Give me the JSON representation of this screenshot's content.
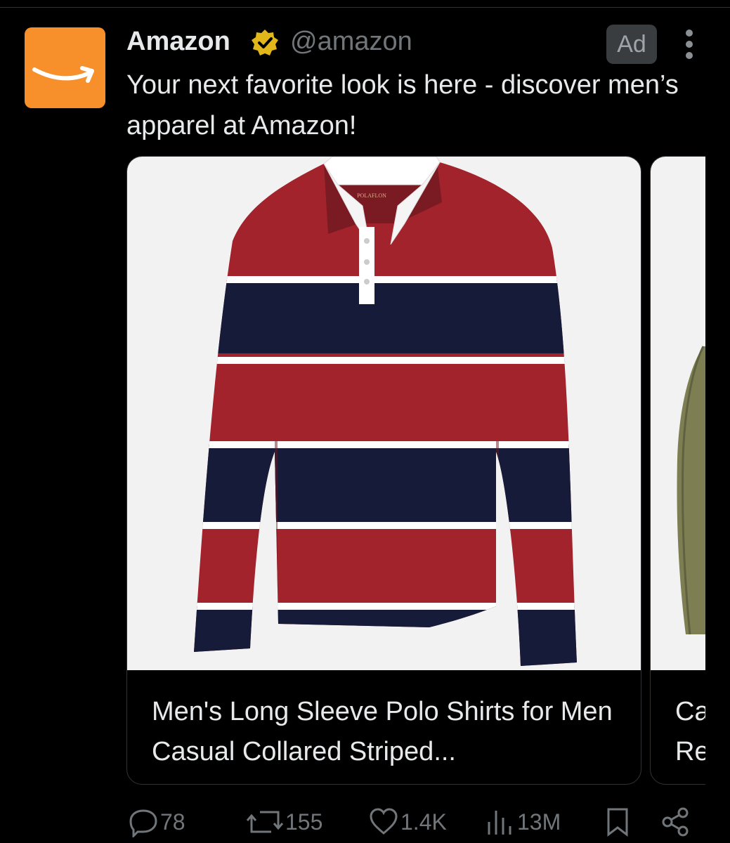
{
  "tweet": {
    "author_name": "Amazon",
    "author_handle": "@amazon",
    "ad_label": "Ad",
    "text": "Your next favorite look is here - discover men’s apparel at Amazon!"
  },
  "cards": [
    {
      "title": "Men's Long Sleeve Polo Shirts for Men Casual Collared Striped...",
      "image": "striped-rugby-polo"
    },
    {
      "title": "Ca Re",
      "image": "olive-puffer-jacket"
    }
  ],
  "actions": {
    "replies": "78",
    "reposts": "155",
    "likes": "1.4K",
    "views": "13M"
  },
  "shirt_label": "POLAFLON",
  "colors": {
    "background": "#000000",
    "text": "#e7e9ea",
    "muted": "#71767b",
    "avatar": "#f7902a",
    "badge": "#e2b719",
    "shirt_red": "#a3232d",
    "shirt_navy": "#151b38"
  },
  "icons": [
    "amazon-smile-icon",
    "verified-badge-icon",
    "more-icon",
    "reply-icon",
    "repost-icon",
    "like-icon",
    "views-icon",
    "bookmark-icon",
    "share-icon"
  ]
}
